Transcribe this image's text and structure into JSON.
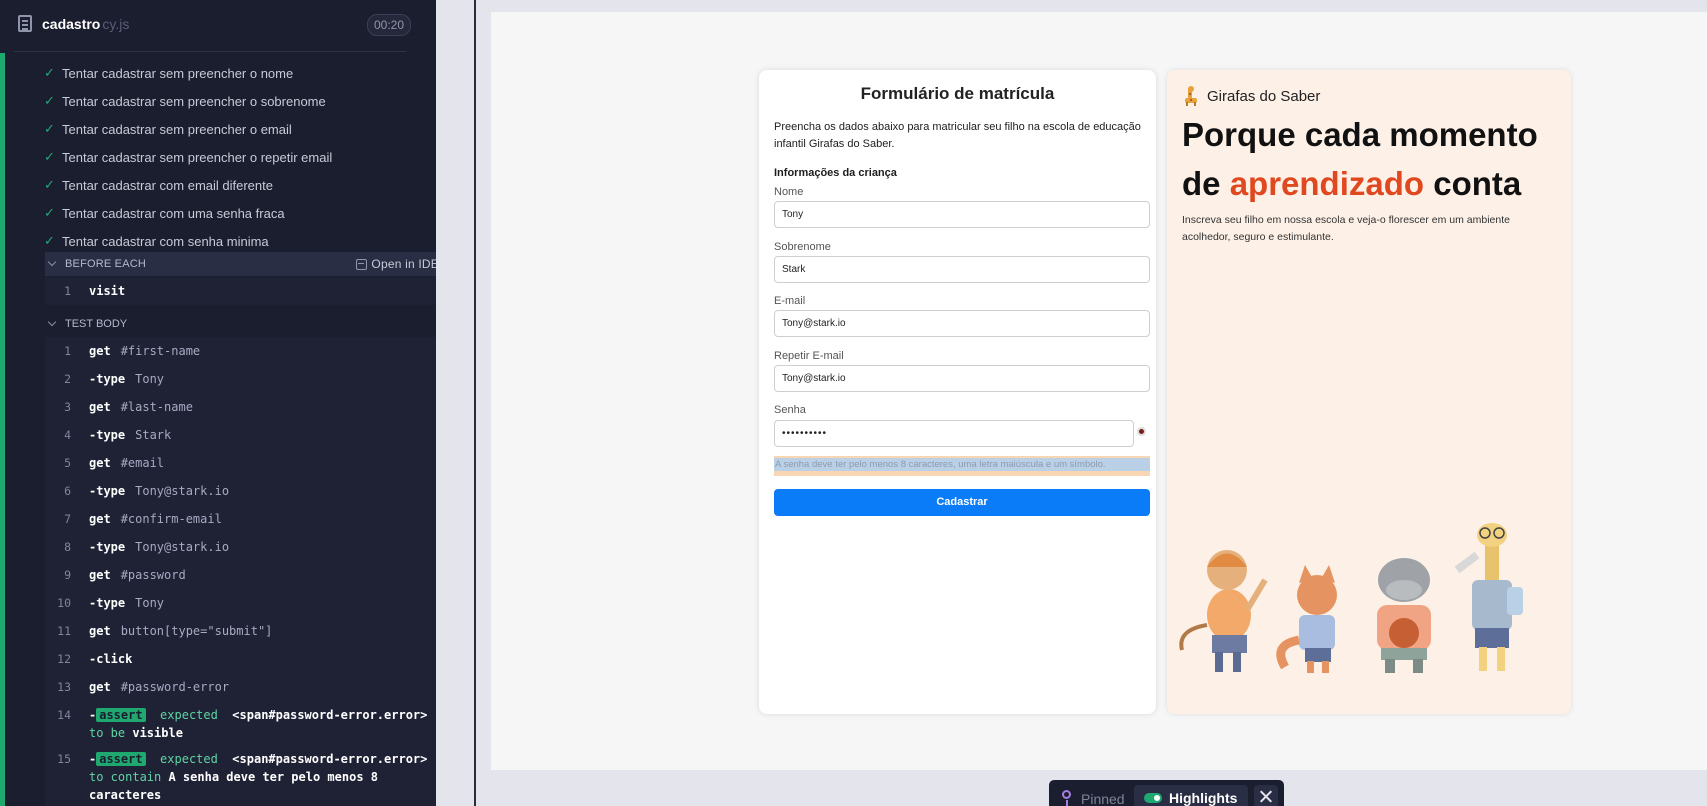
{
  "runner": {
    "spec_name": "cadastro",
    "spec_ext": "cy.js",
    "duration": "00:20",
    "tests": [
      "Tentar cadastrar sem preencher o nome",
      "Tentar cadastrar sem preencher o sobrenome",
      "Tentar cadastrar sem preencher o email",
      "Tentar cadastrar sem preencher o repetir email",
      "Tentar cadastrar com email diferente",
      "Tentar cadastrar com uma senha fraca",
      "Tentar cadastrar com senha minima"
    ],
    "before_each_label": "BEFORE EACH",
    "open_in_ide_label": "Open in IDE",
    "before_each_commands": [
      {
        "num": "1",
        "name": "visit",
        "arg": ""
      }
    ],
    "test_body_label": "TEST BODY",
    "commands": [
      {
        "num": "1",
        "name": "get",
        "arg": "#first-name"
      },
      {
        "num": "2",
        "name": "-type",
        "arg": "Tony"
      },
      {
        "num": "3",
        "name": "get",
        "arg": "#last-name"
      },
      {
        "num": "4",
        "name": "-type",
        "arg": "Stark"
      },
      {
        "num": "5",
        "name": "get",
        "arg": "#email"
      },
      {
        "num": "6",
        "name": "-type",
        "arg": "Tony@stark.io"
      },
      {
        "num": "7",
        "name": "get",
        "arg": "#confirm-email"
      },
      {
        "num": "8",
        "name": "-type",
        "arg": "Tony@stark.io"
      },
      {
        "num": "9",
        "name": "get",
        "arg": "#password"
      },
      {
        "num": "10",
        "name": "-type",
        "arg": "Tony"
      },
      {
        "num": "11",
        "name": "get",
        "arg": "button[type=\"submit\"]"
      },
      {
        "num": "12",
        "name": "-click",
        "arg": ""
      },
      {
        "num": "13",
        "name": "get",
        "arg": "#password-error"
      }
    ],
    "asserts": [
      {
        "num": "14",
        "dash": "-",
        "badge": "assert",
        "expected": "expected",
        "subject": "<span#password-error.error>",
        "line2_kw": "to be",
        "line2_val": "visible",
        "line3": ""
      },
      {
        "num": "15",
        "dash": "-",
        "badge": "assert",
        "expected": "expected",
        "subject": "<span#password-error.error>",
        "line2_kw": "to contain",
        "line2_val": "A senha deve ter pelo menos 8",
        "line3": "caracteres"
      }
    ]
  },
  "form": {
    "title": "Formulário de matrícula",
    "intro": "Preencha os dados abaixo para matricular seu filho na escola de educação infantil Girafas do Saber.",
    "section": "Informações da criança",
    "fields": [
      {
        "label": "Nome",
        "value": "Tony"
      },
      {
        "label": "Sobrenome",
        "value": "Stark"
      },
      {
        "label": "E-mail",
        "value": "Tony@stark.io"
      },
      {
        "label": "Repetir E-mail",
        "value": "Tony@stark.io"
      }
    ],
    "password_label": "Senha",
    "password_value": "••••••••••",
    "password_error": "A senha deve ter pelo menos 8 caracteres, uma letra maiúscula e um símbolo.",
    "submit_label": "Cadastrar"
  },
  "promo": {
    "brand": "Girafas do Saber",
    "headline_part1": "Porque cada momento de ",
    "headline_accent": "aprendizado",
    "headline_part2": " conta",
    "text": "Inscreva seu filho em nossa escola e veja-o florescer em um ambiente acolhedor, seguro e estimulante."
  },
  "pin_bar": {
    "pinned_label": "Pinned",
    "highlights_label": "Highlights"
  },
  "colors": {
    "accent_green": "#1fa971",
    "accent_orange": "#e0491f",
    "button_blue": "#0a7cf8"
  }
}
